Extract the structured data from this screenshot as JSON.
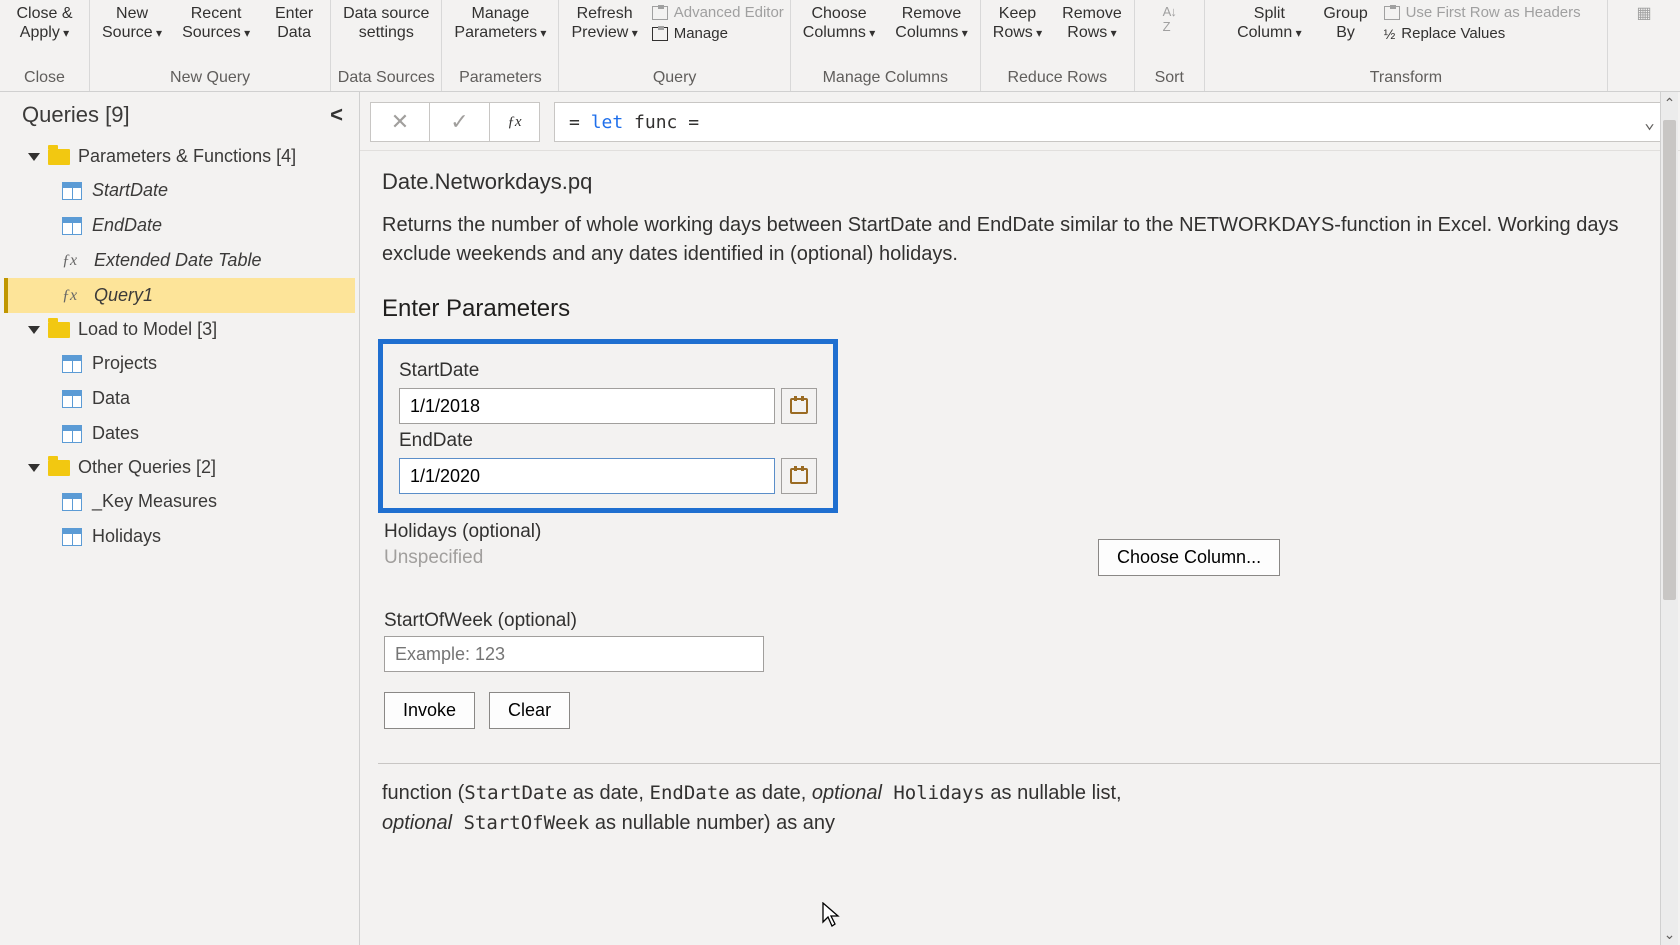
{
  "ribbon": {
    "close": {
      "line1": "Close &",
      "line2": "Apply"
    },
    "newSource": {
      "line1": "New",
      "line2": "Source"
    },
    "recentSources": {
      "line1": "Recent",
      "line2": "Sources"
    },
    "enterData": {
      "line1": "Enter",
      "line2": "Data"
    },
    "dataSourceSettings": {
      "line1": "Data source",
      "line2": "settings"
    },
    "manageParams": {
      "line1": "Manage",
      "line2": "Parameters"
    },
    "refreshPreview": {
      "line1": "Refresh",
      "line2": "Preview"
    },
    "advancedEditor": "Advanced Editor",
    "manage": "Manage",
    "chooseCols": {
      "line1": "Choose",
      "line2": "Columns"
    },
    "removeCols": {
      "line1": "Remove",
      "line2": "Columns"
    },
    "keepRows": {
      "line1": "Keep",
      "line2": "Rows"
    },
    "removeRows": {
      "line1": "Remove",
      "line2": "Rows"
    },
    "splitCol": {
      "line1": "Split",
      "line2": "Column"
    },
    "groupBy": {
      "line1": "Group",
      "line2": "By"
    },
    "useFirstRow": "Use First Row as Headers",
    "replaceValues": "Replace Values",
    "groups": {
      "close": "Close",
      "newQuery": "New Query",
      "dataSources": "Data Sources",
      "parameters": "Parameters",
      "query": "Query",
      "manageCols": "Manage Columns",
      "reduceRows": "Reduce Rows",
      "sort": "Sort",
      "transform": "Transform"
    }
  },
  "queriesPanel": {
    "header": "Queries [9]",
    "groups": [
      {
        "label": "Parameters & Functions [4]",
        "items": [
          {
            "label": "StartDate",
            "type": "table",
            "italic": true
          },
          {
            "label": "EndDate",
            "type": "table",
            "italic": true
          },
          {
            "label": "Extended Date Table",
            "type": "fx",
            "italic": true
          },
          {
            "label": "Query1",
            "type": "fx",
            "italic": true,
            "selected": true
          }
        ]
      },
      {
        "label": "Load to Model [3]",
        "items": [
          {
            "label": "Projects",
            "type": "table"
          },
          {
            "label": "Data",
            "type": "table"
          },
          {
            "label": "Dates",
            "type": "table"
          }
        ]
      },
      {
        "label": "Other Queries [2]",
        "items": [
          {
            "label": "_Key Measures",
            "type": "table"
          },
          {
            "label": "Holidays",
            "type": "table"
          }
        ]
      }
    ]
  },
  "formulaBar": {
    "prefix": "= ",
    "kw1": "let",
    "mid": " func ",
    "eq": "="
  },
  "content": {
    "title": "Date.Networkdays.pq",
    "description": "Returns the number of whole working days between StartDate and EndDate similar to the NETWORKDAYS-function in Excel. Working days exclude weekends and any dates identified in (optional) holidays.",
    "enterParams": "Enter Parameters",
    "params": {
      "startDateLabel": "StartDate",
      "startDateValue": "1/1/2018",
      "endDateLabel": "EndDate",
      "endDateValue": "1/1/2020",
      "holidaysLabel": "Holidays (optional)",
      "holidaysValue": "Unspecified",
      "startOfWeekLabel": "StartOfWeek (optional)",
      "startOfWeekPlaceholder": "Example: 123"
    },
    "chooseColumn": "Choose Column...",
    "invoke": "Invoke",
    "clear": "Clear",
    "signature": {
      "p1": "function (",
      "a1": "StartDate",
      "t1": " as date, ",
      "a2": "EndDate",
      "t2": " as date, ",
      "opt": "optional",
      "a3": " Holidays",
      "t3": " as nullable list,",
      "a4": " StartOfWeek",
      "t4": " as nullable number) as any"
    }
  }
}
